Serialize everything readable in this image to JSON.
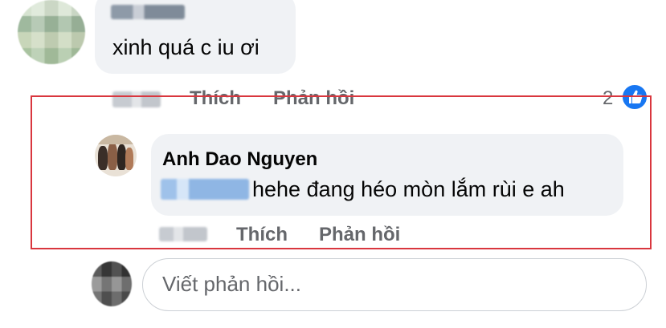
{
  "comment": {
    "text": "xinh quá c iu ơi",
    "actions": {
      "like_label": "Thích",
      "reply_label": "Phản hồi"
    },
    "reaction_count": "2"
  },
  "reply": {
    "author": "Anh Dao Nguyen",
    "text": "hehe đang héo mòn lắm rùi e ah",
    "actions": {
      "like_label": "Thích",
      "reply_label": "Phản hồi"
    }
  },
  "reply_box": {
    "placeholder": "Viết phản hồi..."
  },
  "colors": {
    "bubble_bg": "#f0f2f5",
    "action_text": "#65676b",
    "like_blue": "#1877f2",
    "highlight_red": "#d9363e"
  },
  "icons": {
    "reaction": "thumbs-up-icon"
  }
}
